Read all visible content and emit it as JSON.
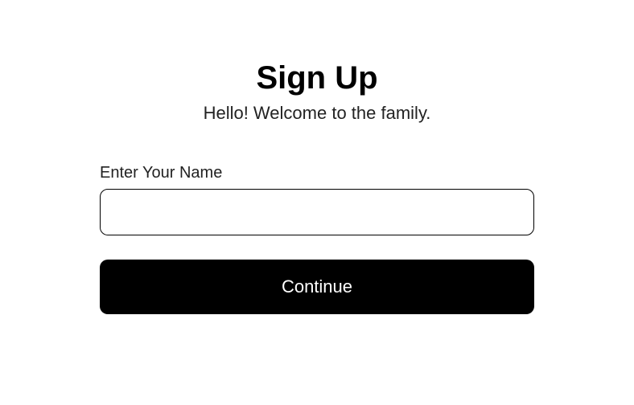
{
  "signup": {
    "title": "Sign Up",
    "subtitle": "Hello! Welcome to the family.",
    "name_field": {
      "label": "Enter Your Name",
      "value": "",
      "placeholder": ""
    },
    "continue_button_label": "Continue"
  }
}
